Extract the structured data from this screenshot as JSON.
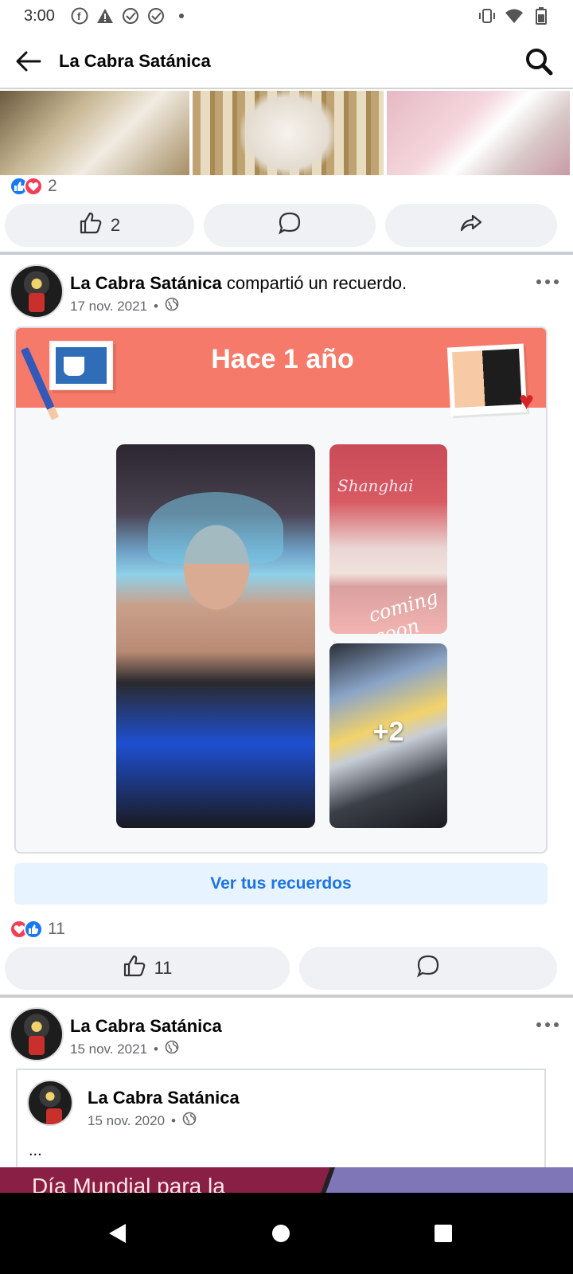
{
  "status_bar": {
    "time": "3:00",
    "icons": [
      "facebook-icon",
      "warning-icon",
      "check-circle-icon",
      "check-circle-icon",
      "dot-icon"
    ],
    "right_icons": [
      "vibrate-icon",
      "wifi-icon",
      "battery-icon"
    ]
  },
  "app_bar": {
    "title": "La Cabra Satánica"
  },
  "post1": {
    "reactions_count": "2",
    "like_count": "2"
  },
  "post2": {
    "author": "La Cabra Satánica",
    "action_text": " compartió un recuerdo.",
    "date": "17 nov. 2021",
    "memory": {
      "title": "Hace 1 año",
      "photo_text_shanghai": "Shanghai",
      "photo_text_coming": "coming soon",
      "more_count": "+2"
    },
    "see_memories_label": "Ver tus recuerdos",
    "reactions_count": "11",
    "like_count": "11"
  },
  "post3": {
    "author": "La Cabra Satánica",
    "date": "15 nov. 2021",
    "shared": {
      "author": "La Cabra Satánica",
      "date": "15 nov. 2020",
      "text": "...",
      "banner_text": "Día Mundial para la"
    }
  },
  "colors": {
    "brand_blue": "#1877f2",
    "love_red": "#f33e58",
    "memory_coral": "#f67a69",
    "link_blue": "#1b74e4"
  }
}
